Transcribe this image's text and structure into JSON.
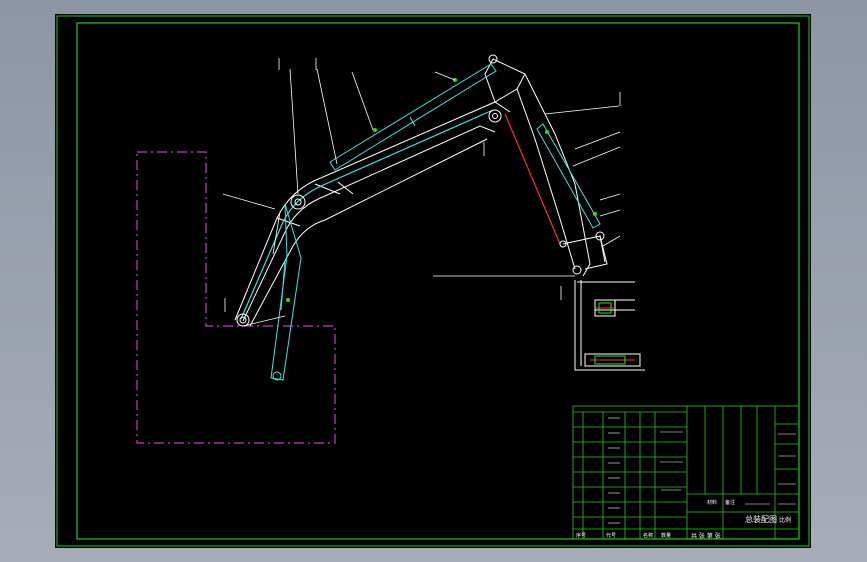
{
  "drawing": {
    "colors": {
      "background": "#000000",
      "frame": "#22c922",
      "linework": "#ffffff",
      "cylinder": "#40e0e0",
      "accent": "#ff2a2a",
      "outline_dashed": "#c040c0",
      "title_block": "#22c922"
    }
  },
  "title_block": {
    "main_label": "总装配图",
    "scale_label": "比例",
    "sheet_label": "共 张 第 张",
    "cells": [
      "序号",
      "代号",
      "名称",
      "数量",
      "材料",
      "备注"
    ]
  }
}
